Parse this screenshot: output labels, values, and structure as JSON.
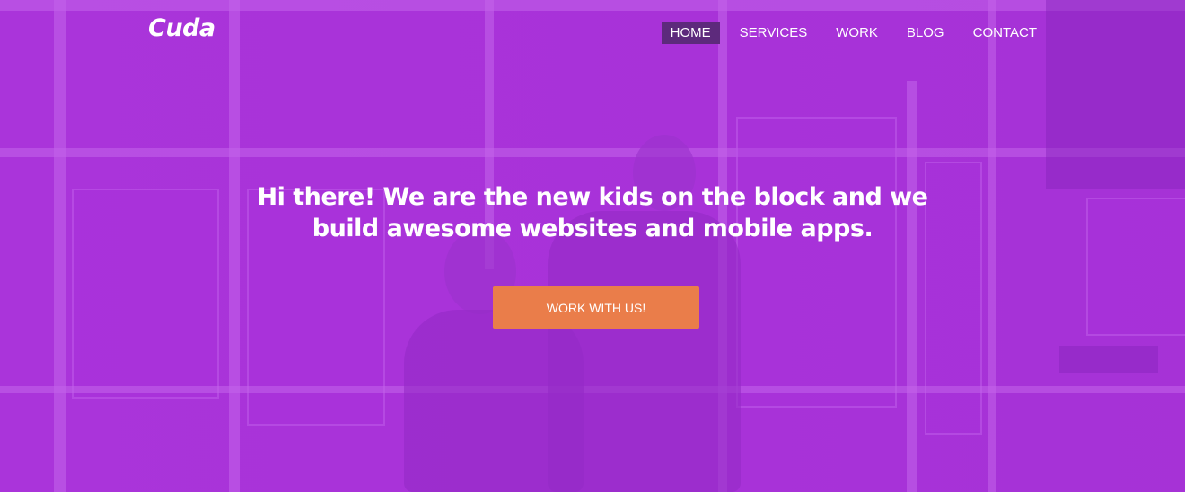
{
  "brand": {
    "logo_text": "Cuda"
  },
  "nav": {
    "items": [
      {
        "label": "HOME",
        "active": true
      },
      {
        "label": "SERVICES",
        "active": false
      },
      {
        "label": "WORK",
        "active": false
      },
      {
        "label": "BLOG",
        "active": false
      },
      {
        "label": "CONTACT",
        "active": false
      }
    ]
  },
  "hero": {
    "headline_line1": "Hi there! We are the new kids on the block and we",
    "headline_line2": "build awesome websites and mobile apps.",
    "cta_label": "WORK WITH US!"
  },
  "colors": {
    "hero_overlay": "#ab35da",
    "nav_active_bg": "#5d2a7c",
    "cta_bg": "#ea7d4a",
    "text": "#ffffff"
  }
}
